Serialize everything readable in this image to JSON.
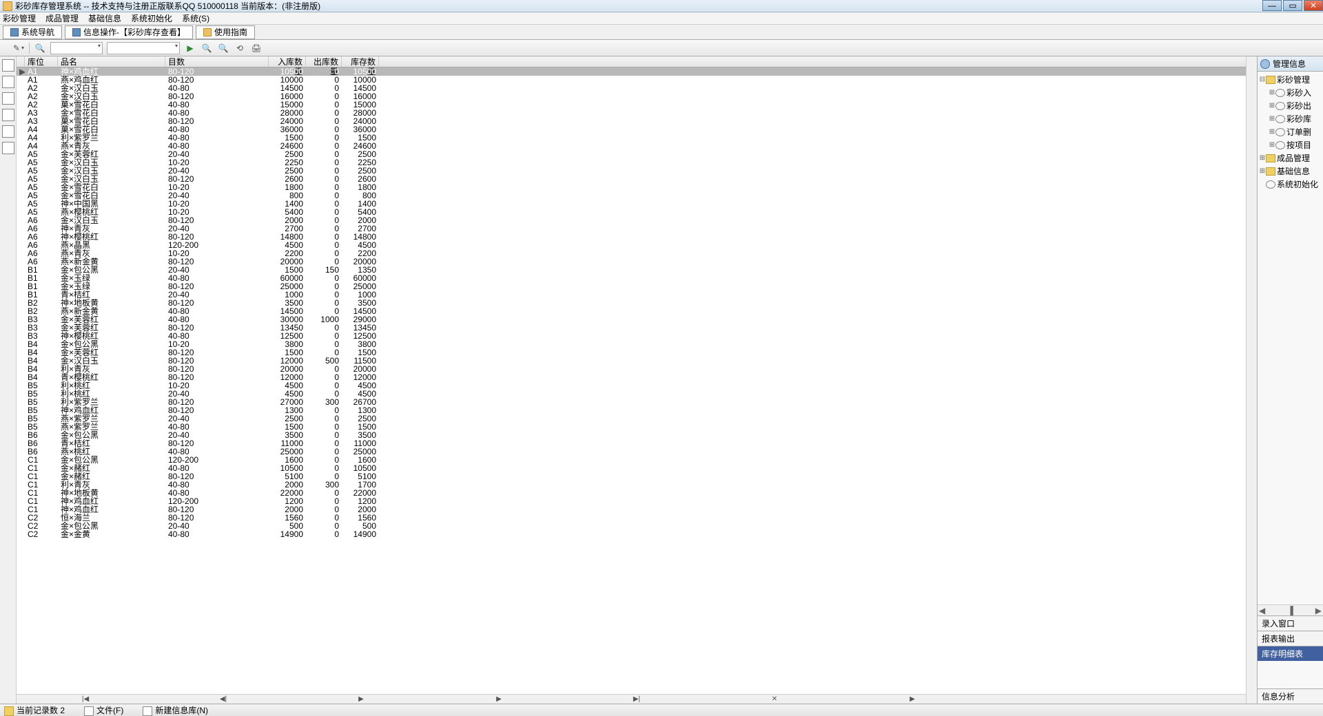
{
  "title": "彩砂库存管理系统 -- 技术支持与注册正版联系QQ 510000118    当前版本：(非注册版)",
  "menu": [
    "彩砂管理",
    "成品管理",
    "基础信息",
    "系统初始化",
    "系统(S)"
  ],
  "tabs": [
    {
      "label": "系统导航"
    },
    {
      "label": "信息操作-【彩砂库存查看】"
    },
    {
      "label": "使用指南"
    }
  ],
  "grid": {
    "headers": {
      "loc": "库位",
      "name": "品名",
      "mesh": "目数",
      "in": "入库数量",
      "out": "出库数量",
      "stock": "库存数量"
    },
    "rows": [
      {
        "loc": "A1",
        "name": "神×鸡血红",
        "mesh": "80-120",
        "in": 10500,
        "out": 0,
        "stock": 10500
      },
      {
        "loc": "A1",
        "name": "燕×鸡血红",
        "mesh": "80-120",
        "in": 10000,
        "out": 0,
        "stock": 10000
      },
      {
        "loc": "A2",
        "name": "金×汉白玉",
        "mesh": "40-80",
        "in": 14500,
        "out": 0,
        "stock": 14500
      },
      {
        "loc": "A2",
        "name": "金×汉白玉",
        "mesh": "80-120",
        "in": 16000,
        "out": 0,
        "stock": 16000
      },
      {
        "loc": "A2",
        "name": "菓×雪花白",
        "mesh": "40-80",
        "in": 15000,
        "out": 0,
        "stock": 15000
      },
      {
        "loc": "A3",
        "name": "金×雪花白",
        "mesh": "40-80",
        "in": 28000,
        "out": 0,
        "stock": 28000
      },
      {
        "loc": "A3",
        "name": "菓×雪花白",
        "mesh": "80-120",
        "in": 24000,
        "out": 0,
        "stock": 24000
      },
      {
        "loc": "A4",
        "name": "菓×雪花白",
        "mesh": "40-80",
        "in": 36000,
        "out": 0,
        "stock": 36000
      },
      {
        "loc": "A4",
        "name": "利×紫罗兰",
        "mesh": "40-80",
        "in": 1500,
        "out": 0,
        "stock": 1500
      },
      {
        "loc": "A4",
        "name": "燕×青灰",
        "mesh": "40-80",
        "in": 24600,
        "out": 0,
        "stock": 24600
      },
      {
        "loc": "A5",
        "name": "金×芙蓉红",
        "mesh": "20-40",
        "in": 2500,
        "out": 0,
        "stock": 2500
      },
      {
        "loc": "A5",
        "name": "金×汉白玉",
        "mesh": "10-20",
        "in": 2250,
        "out": 0,
        "stock": 2250
      },
      {
        "loc": "A5",
        "name": "金×汉白玉",
        "mesh": "20-40",
        "in": 2500,
        "out": 0,
        "stock": 2500
      },
      {
        "loc": "A5",
        "name": "金×汉白玉",
        "mesh": "80-120",
        "in": 2600,
        "out": 0,
        "stock": 2600
      },
      {
        "loc": "A5",
        "name": "金×雪花白",
        "mesh": "10-20",
        "in": 1800,
        "out": 0,
        "stock": 1800
      },
      {
        "loc": "A5",
        "name": "金×雪花白",
        "mesh": "20-40",
        "in": 800,
        "out": 0,
        "stock": 800
      },
      {
        "loc": "A5",
        "name": "神×中国黑",
        "mesh": "10-20",
        "in": 1400,
        "out": 0,
        "stock": 1400
      },
      {
        "loc": "A5",
        "name": "燕×樱桃红",
        "mesh": "10-20",
        "in": 5400,
        "out": 0,
        "stock": 5400
      },
      {
        "loc": "A6",
        "name": "金×汉白玉",
        "mesh": "80-120",
        "in": 2000,
        "out": 0,
        "stock": 2000
      },
      {
        "loc": "A6",
        "name": "神×青灰",
        "mesh": "20-40",
        "in": 2700,
        "out": 0,
        "stock": 2700
      },
      {
        "loc": "A6",
        "name": "神×樱桃红",
        "mesh": "80-120",
        "in": 14800,
        "out": 0,
        "stock": 14800
      },
      {
        "loc": "A6",
        "name": "燕×晶黑",
        "mesh": "120-200",
        "in": 4500,
        "out": 0,
        "stock": 4500
      },
      {
        "loc": "A6",
        "name": "燕×青灰",
        "mesh": "10-20",
        "in": 2200,
        "out": 0,
        "stock": 2200
      },
      {
        "loc": "A6",
        "name": "燕×新金黄",
        "mesh": "80-120",
        "in": 20000,
        "out": 0,
        "stock": 20000
      },
      {
        "loc": "B1",
        "name": "金×包公黑",
        "mesh": "20-40",
        "in": 1500,
        "out": 150,
        "stock": 1350
      },
      {
        "loc": "B1",
        "name": "金×玉绿",
        "mesh": "40-80",
        "in": 60000,
        "out": 0,
        "stock": 60000
      },
      {
        "loc": "B1",
        "name": "金×玉绿",
        "mesh": "80-120",
        "in": 25000,
        "out": 0,
        "stock": 25000
      },
      {
        "loc": "B1",
        "name": "青×桔红",
        "mesh": "20-40",
        "in": 1000,
        "out": 0,
        "stock": 1000
      },
      {
        "loc": "B2",
        "name": "神×地板黄",
        "mesh": "80-120",
        "in": 3500,
        "out": 0,
        "stock": 3500
      },
      {
        "loc": "B2",
        "name": "燕×新金黄",
        "mesh": "40-80",
        "in": 14500,
        "out": 0,
        "stock": 14500
      },
      {
        "loc": "B3",
        "name": "金×芙蓉红",
        "mesh": "40-80",
        "in": 30000,
        "out": 1000,
        "stock": 29000
      },
      {
        "loc": "B3",
        "name": "金×芙蓉红",
        "mesh": "80-120",
        "in": 13450,
        "out": 0,
        "stock": 13450
      },
      {
        "loc": "B3",
        "name": "神×樱桃红",
        "mesh": "40-80",
        "in": 12500,
        "out": 0,
        "stock": 12500
      },
      {
        "loc": "B4",
        "name": "金×包公黑",
        "mesh": "10-20",
        "in": 3800,
        "out": 0,
        "stock": 3800
      },
      {
        "loc": "B4",
        "name": "金×芙蓉红",
        "mesh": "80-120",
        "in": 1500,
        "out": 0,
        "stock": 1500
      },
      {
        "loc": "B4",
        "name": "金×汉白玉",
        "mesh": "80-120",
        "in": 12000,
        "out": 500,
        "stock": 11500
      },
      {
        "loc": "B4",
        "name": "利×青灰",
        "mesh": "80-120",
        "in": 20000,
        "out": 0,
        "stock": 20000
      },
      {
        "loc": "B4",
        "name": "青×樱桃红",
        "mesh": "80-120",
        "in": 12000,
        "out": 0,
        "stock": 12000
      },
      {
        "loc": "B5",
        "name": "利×桃红",
        "mesh": "10-20",
        "in": 4500,
        "out": 0,
        "stock": 4500
      },
      {
        "loc": "B5",
        "name": "利×桃红",
        "mesh": "20-40",
        "in": 4500,
        "out": 0,
        "stock": 4500
      },
      {
        "loc": "B5",
        "name": "利×紫罗兰",
        "mesh": "80-120",
        "in": 27000,
        "out": 300,
        "stock": 26700
      },
      {
        "loc": "B5",
        "name": "神×鸡血红",
        "mesh": "80-120",
        "in": 1300,
        "out": 0,
        "stock": 1300
      },
      {
        "loc": "B5",
        "name": "燕×紫罗兰",
        "mesh": "20-40",
        "in": 2500,
        "out": 0,
        "stock": 2500
      },
      {
        "loc": "B5",
        "name": "燕×紫罗兰",
        "mesh": "40-80",
        "in": 1500,
        "out": 0,
        "stock": 1500
      },
      {
        "loc": "B6",
        "name": "金×包公黑",
        "mesh": "20-40",
        "in": 3500,
        "out": 0,
        "stock": 3500
      },
      {
        "loc": "B6",
        "name": "青×桔红",
        "mesh": "80-120",
        "in": 11000,
        "out": 0,
        "stock": 11000
      },
      {
        "loc": "B6",
        "name": "燕×桃红",
        "mesh": "40-80",
        "in": 25000,
        "out": 0,
        "stock": 25000
      },
      {
        "loc": "C1",
        "name": "金×包公黑",
        "mesh": "120-200",
        "in": 1600,
        "out": 0,
        "stock": 1600
      },
      {
        "loc": "C1",
        "name": "金×赭红",
        "mesh": "40-80",
        "in": 10500,
        "out": 0,
        "stock": 10500
      },
      {
        "loc": "C1",
        "name": "金×赭红",
        "mesh": "80-120",
        "in": 5100,
        "out": 0,
        "stock": 5100
      },
      {
        "loc": "C1",
        "name": "利×青灰",
        "mesh": "40-80",
        "in": 2000,
        "out": 300,
        "stock": 1700
      },
      {
        "loc": "C1",
        "name": "神×地板黄",
        "mesh": "40-80",
        "in": 22000,
        "out": 0,
        "stock": 22000
      },
      {
        "loc": "C1",
        "name": "神×鸡血红",
        "mesh": "120-200",
        "in": 1200,
        "out": 0,
        "stock": 1200
      },
      {
        "loc": "C1",
        "name": "神×鸡血红",
        "mesh": "80-120",
        "in": 2000,
        "out": 0,
        "stock": 2000
      },
      {
        "loc": "C2",
        "name": "恒×海兰",
        "mesh": "80-120",
        "in": 1560,
        "out": 0,
        "stock": 1560
      },
      {
        "loc": "C2",
        "name": "金×包公黑",
        "mesh": "20-40",
        "in": 500,
        "out": 0,
        "stock": 500
      },
      {
        "loc": "C2",
        "name": "金×金黄",
        "mesh": "40-80",
        "in": 14900,
        "out": 0,
        "stock": 14900
      }
    ]
  },
  "rightPanel": {
    "header": "管理信息",
    "tree": [
      {
        "level": 1,
        "exp": "⊟",
        "icon": "folder",
        "label": "彩砂管理"
      },
      {
        "level": 2,
        "exp": "⊞",
        "icon": "mag",
        "label": "彩砂入"
      },
      {
        "level": 2,
        "exp": "⊞",
        "icon": "mag",
        "label": "彩砂出"
      },
      {
        "level": 2,
        "exp": "⊞",
        "icon": "mag",
        "label": "彩砂库"
      },
      {
        "level": 2,
        "exp": "⊞",
        "icon": "mag",
        "label": "订单删"
      },
      {
        "level": 2,
        "exp": "⊞",
        "icon": "mag",
        "label": "按项目"
      },
      {
        "level": 1,
        "exp": "⊞",
        "icon": "folder",
        "label": "成品管理"
      },
      {
        "level": 1,
        "exp": "⊞",
        "icon": "folder",
        "label": "基础信息"
      },
      {
        "level": 1,
        "exp": "",
        "icon": "mag",
        "label": "系统初始化"
      }
    ],
    "sections": [
      "录入窗口",
      "报表输出",
      "库存明细表",
      "信息分析"
    ]
  },
  "status": {
    "records": "当前记录数 2",
    "file": "文件(F)",
    "newdb": "新建信息库(N)"
  }
}
